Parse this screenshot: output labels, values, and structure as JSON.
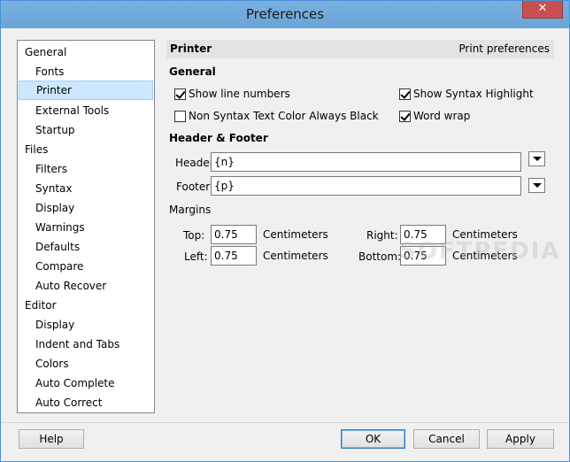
{
  "window": {
    "title": "Preferences"
  },
  "sidebar": {
    "items": [
      {
        "label": "General",
        "level": 0
      },
      {
        "label": "Fonts",
        "level": 1
      },
      {
        "label": "Printer",
        "level": 1,
        "selected": true
      },
      {
        "label": "External Tools",
        "level": 1
      },
      {
        "label": "Startup",
        "level": 1
      },
      {
        "label": "Files",
        "level": 0
      },
      {
        "label": "Filters",
        "level": 1
      },
      {
        "label": "Syntax",
        "level": 1
      },
      {
        "label": "Display",
        "level": 1
      },
      {
        "label": "Warnings",
        "level": 1
      },
      {
        "label": "Defaults",
        "level": 1
      },
      {
        "label": "Compare",
        "level": 1
      },
      {
        "label": "Auto Recover",
        "level": 1
      },
      {
        "label": "Editor",
        "level": 0
      },
      {
        "label": "Display",
        "level": 1
      },
      {
        "label": "Indent and Tabs",
        "level": 1
      },
      {
        "label": "Colors",
        "level": 1
      },
      {
        "label": "Auto Complete",
        "level": 1
      },
      {
        "label": "Auto Correct",
        "level": 1
      }
    ]
  },
  "panel": {
    "title": "Printer",
    "subtitle": "Print preferences",
    "general": {
      "title": "General",
      "show_line_numbers": {
        "label": "Show line numbers",
        "checked": true
      },
      "show_syntax_highlight": {
        "label": "Show Syntax Highlight",
        "checked": true
      },
      "non_syntax_black": {
        "label": "Non Syntax Text Color Always Black",
        "checked": false
      },
      "word_wrap": {
        "label": "Word wrap",
        "checked": true
      }
    },
    "header_footer": {
      "title": "Header & Footer",
      "header_label": "Header:",
      "header_value": "{n}",
      "footer_label": "Footer:",
      "footer_value": "{p}"
    },
    "margins": {
      "title": "Margins",
      "top_label": "Top:",
      "top_value": "0.75",
      "left_label": "Left:",
      "left_value": "0.75",
      "right_label": "Right:",
      "right_value": "0.75",
      "bottom_label": "Bottom:",
      "bottom_value": "0.75",
      "unit": "Centimeters"
    }
  },
  "buttons": {
    "help": "Help",
    "ok": "OK",
    "cancel": "Cancel",
    "apply": "Apply"
  },
  "watermark": "SOFTPEDIA"
}
